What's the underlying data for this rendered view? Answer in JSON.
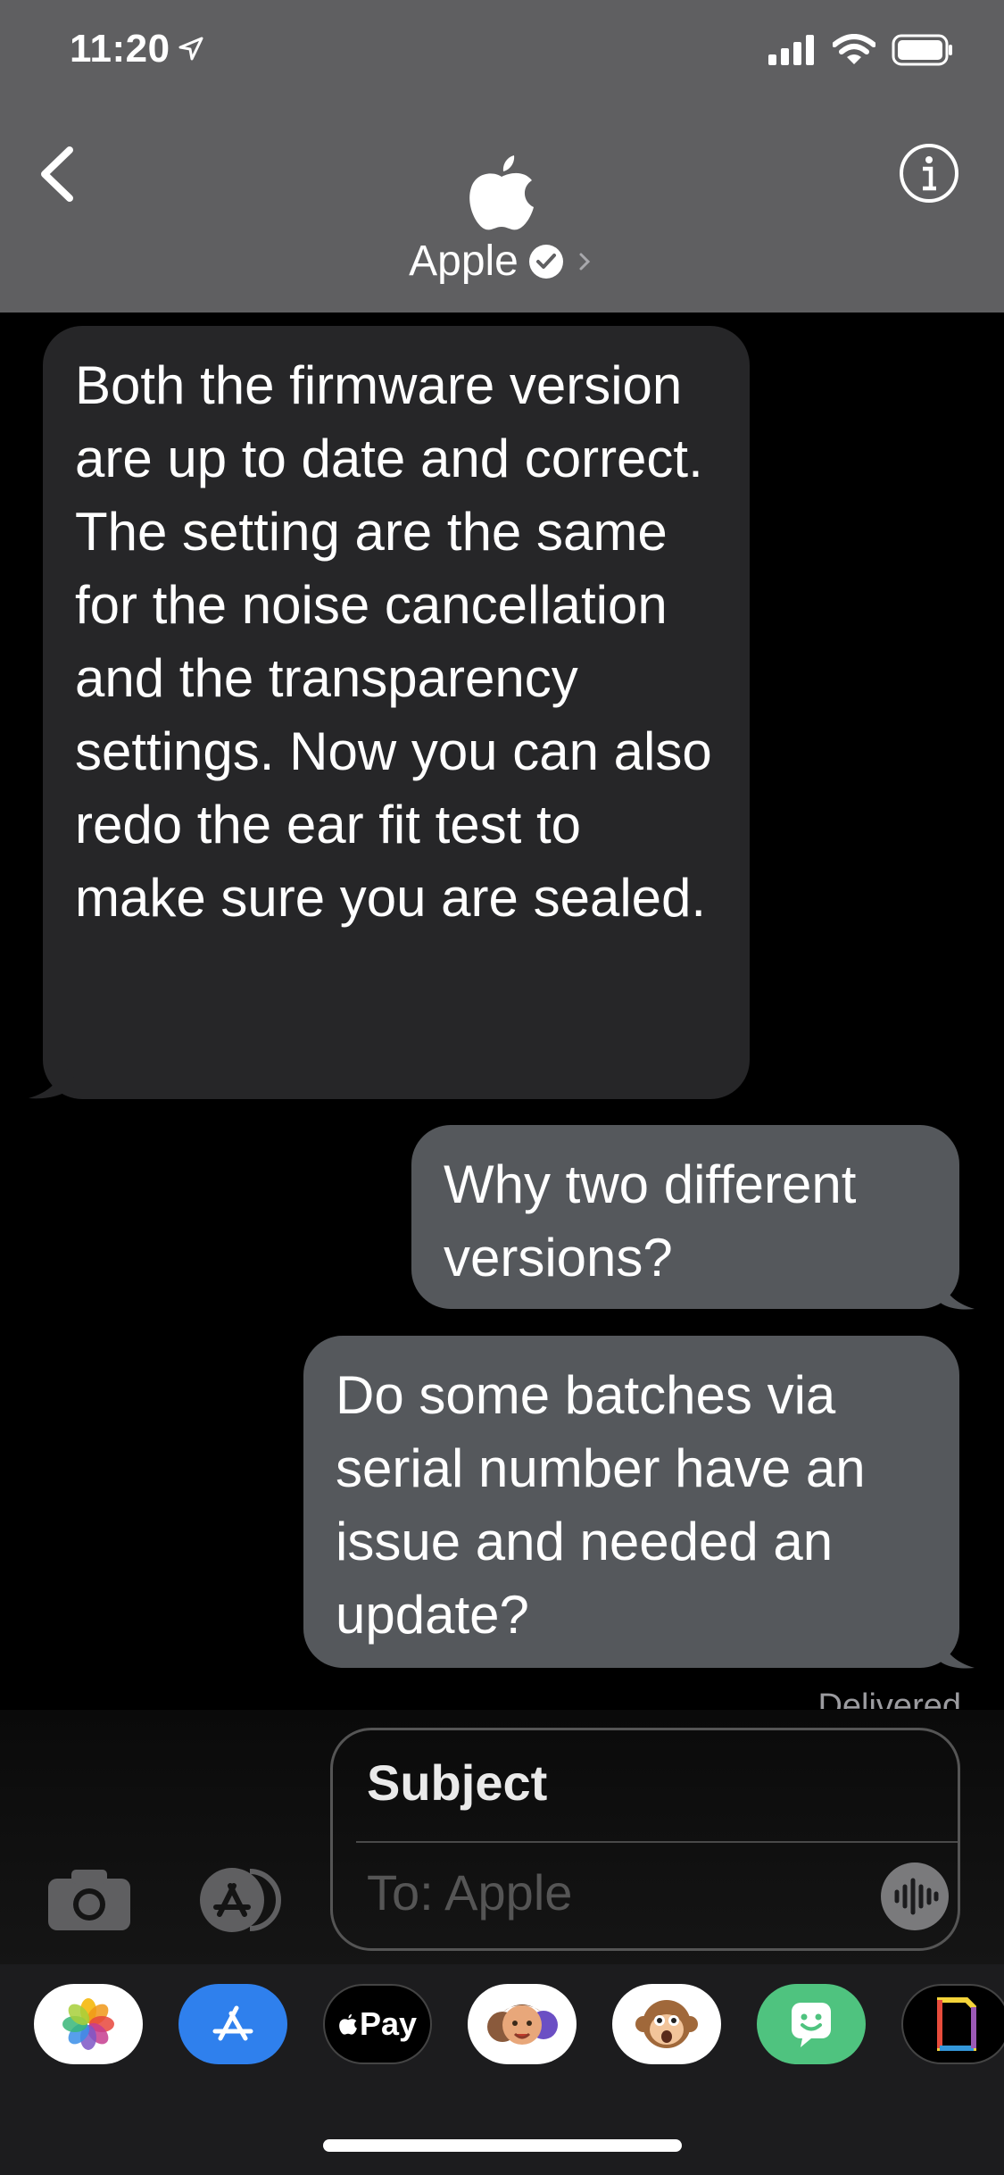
{
  "status_bar": {
    "time": "11:20"
  },
  "header": {
    "contact_name": "Apple"
  },
  "messages": [
    {
      "direction": "incoming",
      "text": "Both the firmware version are up to date and correct. The setting are the same for the noise cancellation and the transparency settings. Now you can also redo the ear fit test to make sure you are sealed."
    },
    {
      "direction": "outgoing",
      "text": "Why two different versions?"
    },
    {
      "direction": "outgoing",
      "text": "Do some batches via serial number have an issue and needed an update?"
    }
  ],
  "status_text": "Delivered",
  "composer": {
    "subject_placeholder": "Subject",
    "to_placeholder": "To: Apple"
  },
  "app_drawer": {
    "apple_pay_label": "Pay"
  },
  "colors": {
    "header_bg": "#5f5f61",
    "incoming_bubble": "#262628",
    "outgoing_bubble": "#55585c",
    "background": "#000000"
  }
}
